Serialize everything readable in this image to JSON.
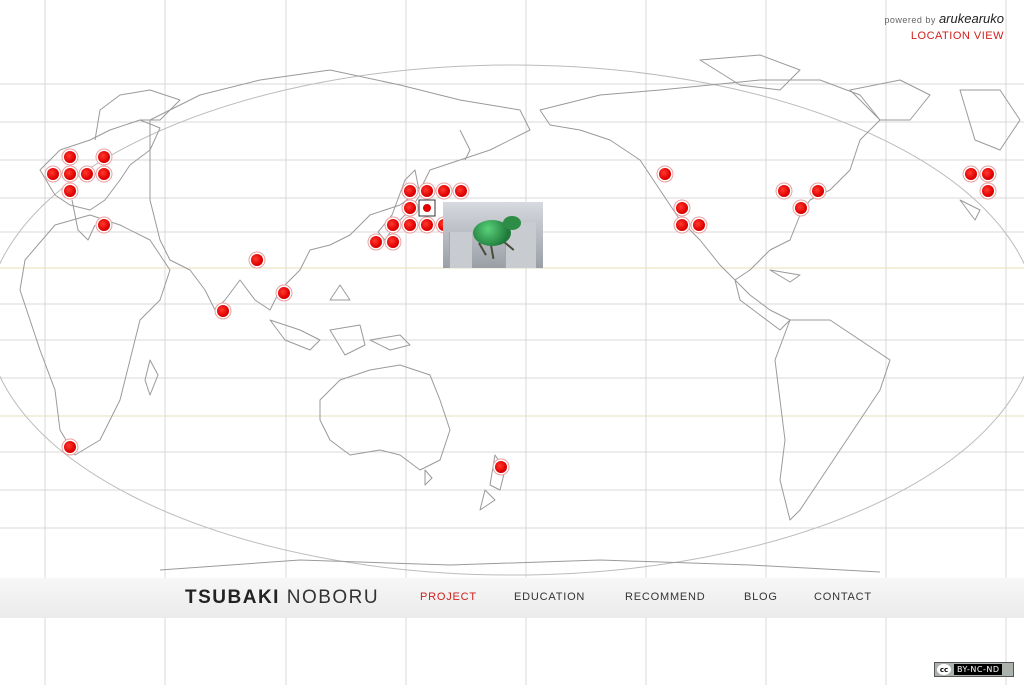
{
  "header": {
    "powered_prefix": "powered by",
    "powered_brand": "arukearuko",
    "location_view": "LOCATION VIEW"
  },
  "brand": {
    "name_bold": "TSUBAKI",
    "name_light": "NOBORU"
  },
  "nav": {
    "items": [
      {
        "label": "PROJECT",
        "active": true
      },
      {
        "label": "EDUCATION",
        "active": false
      },
      {
        "label": "RECOMMEND",
        "active": false
      },
      {
        "label": "BLOG",
        "active": false
      },
      {
        "label": "CONTACT",
        "active": false
      }
    ]
  },
  "map": {
    "marker_color": "#e00000",
    "grid_color": "#d8d8d8",
    "outline_color": "#9a9a9a",
    "accent_line_color": "#e6e2b8",
    "selected_thumbnail": "bug-sculpture-thumbnail"
  },
  "license": {
    "cc_label": "cc",
    "terms": "BY-NC-ND"
  }
}
